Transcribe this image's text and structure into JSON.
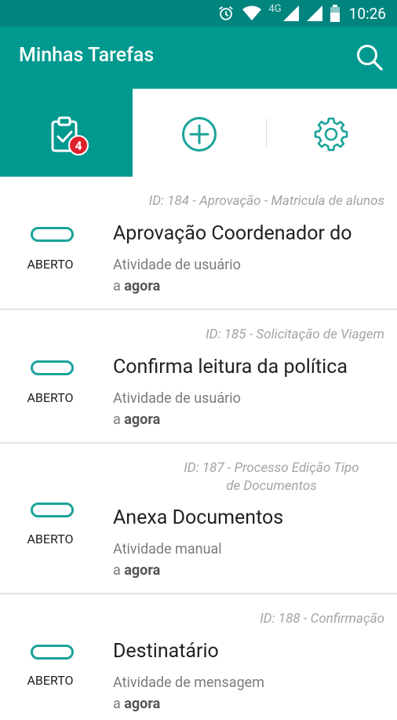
{
  "status_bar": {
    "network": "4G",
    "time": "10:26"
  },
  "app_bar": {
    "title": "Minhas Tarefas"
  },
  "tabs": {
    "tasks_badge": "4"
  },
  "tasks": [
    {
      "id_text": "ID: 184 - Aprovação - Matricula de alunos",
      "status": "ABERTO",
      "title": "Aprovação Coordenador do",
      "type": "Atividade de usuário",
      "time_prefix": "a",
      "time": "agora"
    },
    {
      "id_text": "ID: 185 - Solicitação de Viagem",
      "status": "ABERTO",
      "title": "Confirma leitura da política",
      "type": "Atividade de usuário",
      "time_prefix": "a",
      "time": "agora"
    },
    {
      "id_text": "ID: 187 - Processo Edição Tipo de Documentos",
      "status": "ABERTO",
      "title": "Anexa Documentos",
      "type": "Atividade manual",
      "time_prefix": "a",
      "time": "agora"
    },
    {
      "id_text": "ID: 188 - Confirmação",
      "status": "ABERTO",
      "title": "Destinatário",
      "type": "Atividade de mensagem",
      "time_prefix": "a",
      "time": "agora"
    }
  ],
  "colors": {
    "primary": "#00998f",
    "status_bar": "#00857e",
    "badge": "#e0202a",
    "accent": "#1aa39a"
  }
}
